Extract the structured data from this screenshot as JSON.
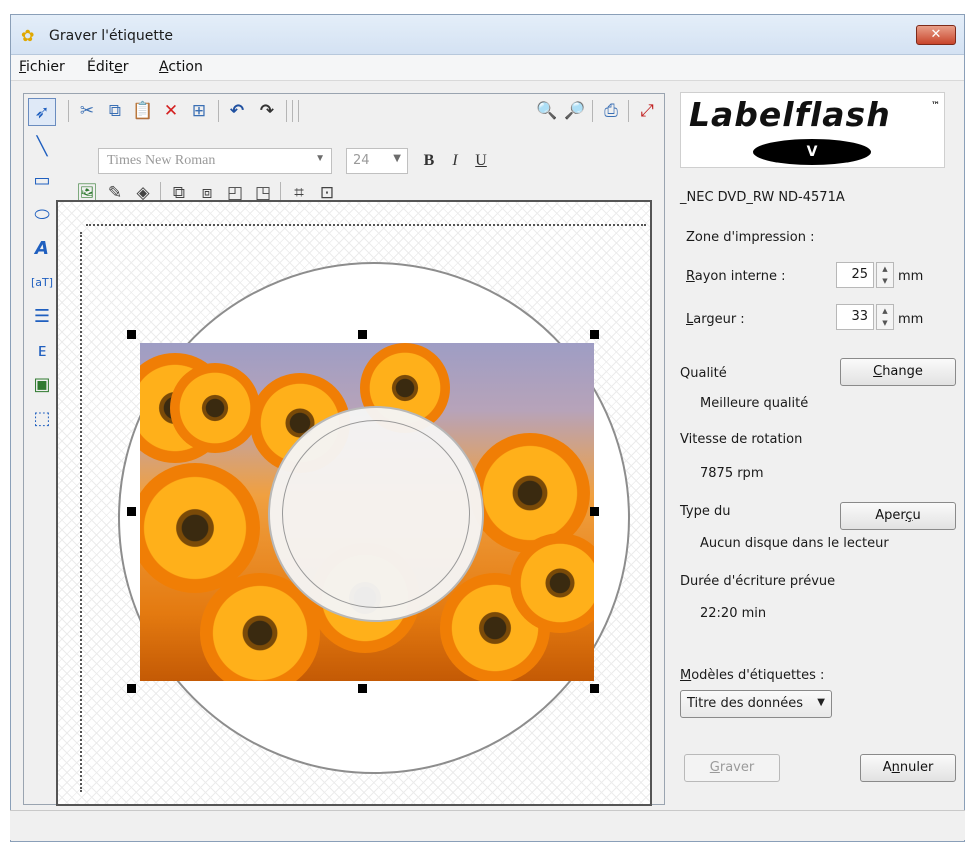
{
  "window": {
    "title": "Graver l'étiquette",
    "close_label": "✕"
  },
  "menu": [
    {
      "label_u": "F",
      "label_rest": "ichier"
    },
    {
      "label_pre": "Édit",
      "label_u": "e",
      "label_rest": "r"
    },
    {
      "label_u": "A",
      "label_rest": "ction"
    }
  ],
  "toolbar": {
    "font": "Times New Roman",
    "size": "24",
    "bold": "B",
    "italic": "I",
    "underline": "U"
  },
  "icons": {
    "tools": [
      "select-arrow-icon",
      "line-icon",
      "rectangle-icon",
      "ellipse-icon",
      "text-icon",
      "textbox-icon",
      "list-icon",
      "tree-icon",
      "image-icon",
      "frame-icon"
    ],
    "toolbar_row1": [
      "cut-icon",
      "copy-icon",
      "paste-icon",
      "delete-icon",
      "duplicate-icon",
      "undo-icon",
      "redo-icon",
      "zoom-in-icon",
      "zoom-out-icon",
      "preview-icon",
      "fit-icon"
    ],
    "toolbar_row3": [
      "picture-icon",
      "pen-icon",
      "fill-icon",
      "bring-forward-icon",
      "send-backward-icon",
      "bring-front-icon",
      "send-back-icon",
      "align-icon",
      "center-icon"
    ]
  },
  "panel": {
    "logo": "Labelflash",
    "logo_tm": "™",
    "logo_v": "V",
    "drive": "_NEC DVD_RW ND-4571A",
    "print_zone": "Zone d'impression :",
    "inner_radius_label_u": "R",
    "inner_radius_label_rest": "ayon interne :",
    "inner_radius_value": "25",
    "width_label_u": "L",
    "width_label_rest": "argeur :",
    "width_value": "33",
    "unit": "mm",
    "quality_label": "Qualité",
    "quality_value": "Meilleure qualité",
    "change_button_u": "C",
    "change_button_rest": "hange",
    "rotation_label": "Vitesse de rotation",
    "rotation_value": "7875 rpm",
    "type_label": "Type du",
    "type_value": "Aucun disque dans le lecteur",
    "preview_button_pre": "Aper",
    "preview_button_u": "ç",
    "preview_button_rest": "u",
    "duration_label": "Durée d'écriture prévue",
    "duration_value": "22:20 min",
    "templates_label_u": "M",
    "templates_label_rest": "odèles d'étiquettes :",
    "template_selected": "Titre des données",
    "burn_button_u": "G",
    "burn_button_rest": "raver",
    "cancel_button_pre": "A",
    "cancel_button_u": "n",
    "cancel_button_rest": "nuler"
  },
  "colors": {
    "accent": "#1f5fbf",
    "photo_orange": "#f08a10",
    "disc_border": "#8d8d8d"
  }
}
